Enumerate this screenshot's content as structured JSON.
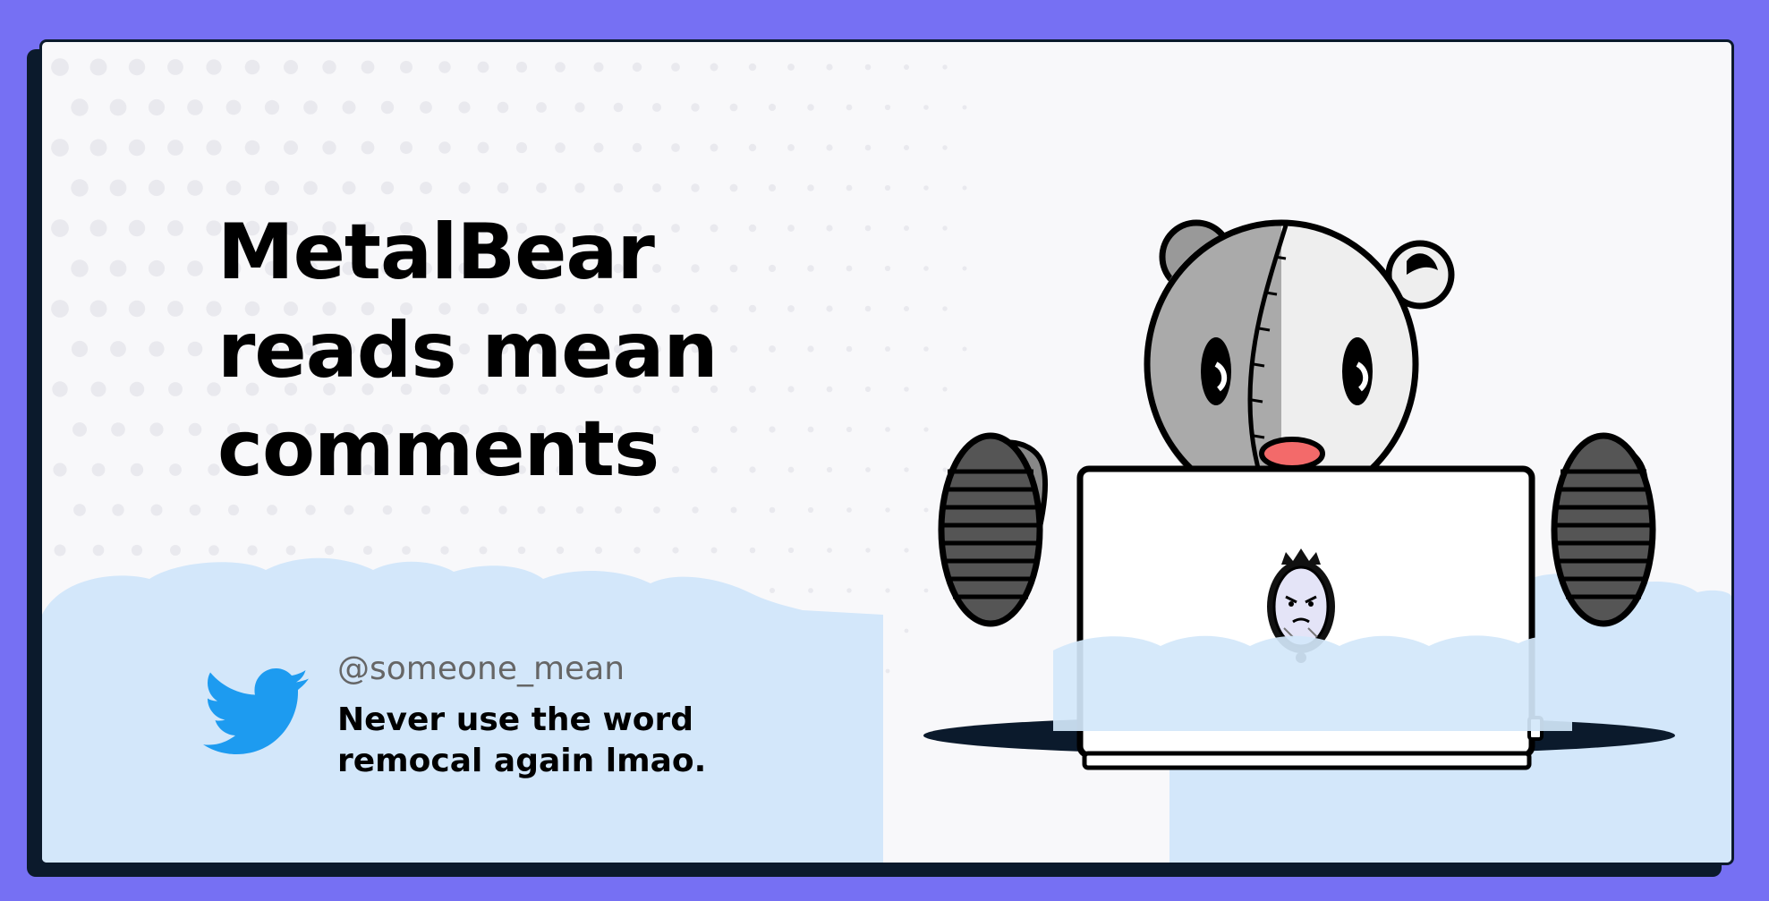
{
  "headline": {
    "line1": "MetalBear",
    "line2": "reads mean",
    "line3": "comments"
  },
  "tweet": {
    "handle": "@someone_mean",
    "text": "Never use the word remocal again lmao."
  },
  "icons": {
    "twitter": "twitter-bird-icon",
    "mascot": "metalbear-mascot",
    "laptop_sticker": "angry-mirror-sticker"
  },
  "colors": {
    "frame": "#7670f3",
    "card": "#f8f8fa",
    "cloud": "#d3e7fa",
    "twitter_blue": "#1d9bf0",
    "outline": "#0b1a2c"
  }
}
